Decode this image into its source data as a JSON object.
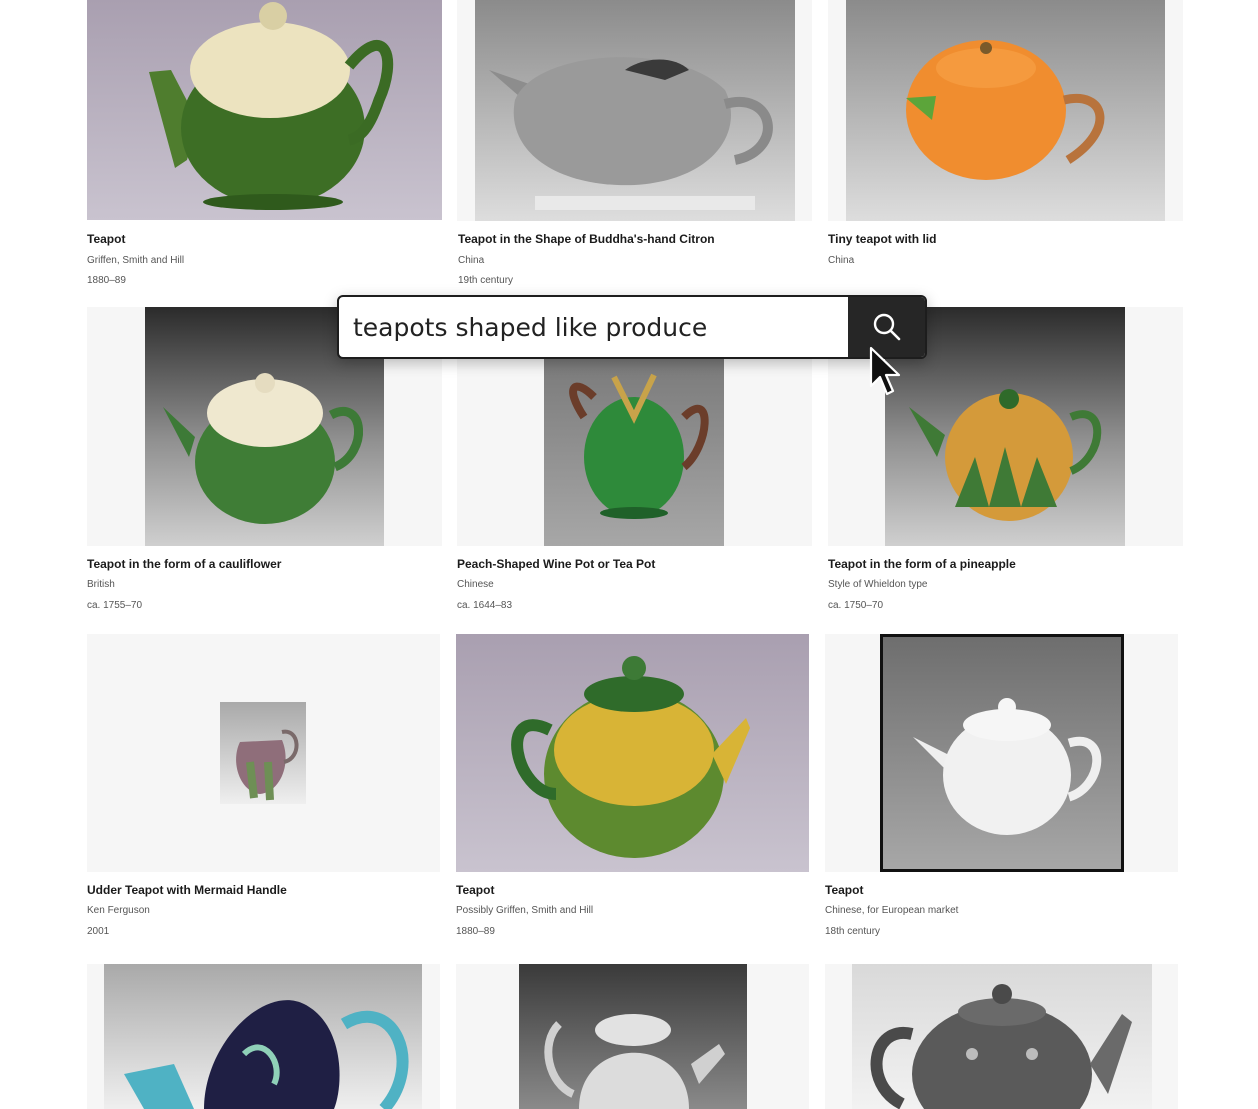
{
  "search": {
    "value": "teapots shaped like produce",
    "button_icon": "search-icon"
  },
  "results": [
    {
      "title": "Teapot",
      "maker": "Griffen, Smith and Hill",
      "date": "1880–89"
    },
    {
      "title": "Teapot in the Shape of Buddha's-hand Citron",
      "maker": "China",
      "date": "19th century"
    },
    {
      "title": "Tiny teapot with lid",
      "maker": "China",
      "date": ""
    },
    {
      "title": "Teapot in the form of a cauliflower",
      "maker": "British",
      "date": "ca. 1755–70"
    },
    {
      "title": "Peach-Shaped Wine Pot or Tea Pot",
      "maker": "Chinese",
      "date": "ca. 1644–83"
    },
    {
      "title": "Teapot in the form of a pineapple",
      "maker": "Style of Whieldon type",
      "date": "ca. 1750–70"
    },
    {
      "title": "Udder Teapot with Mermaid Handle",
      "maker": "Ken Ferguson",
      "date": "2001"
    },
    {
      "title": "Teapot",
      "maker": "Possibly Griffen, Smith and Hill",
      "date": "1880–89"
    },
    {
      "title": "Teapot",
      "maker": "Chinese, for European market",
      "date": "18th century"
    }
  ],
  "colors": {
    "search_button": "#262626",
    "card_frame": "#f6f6f6"
  }
}
